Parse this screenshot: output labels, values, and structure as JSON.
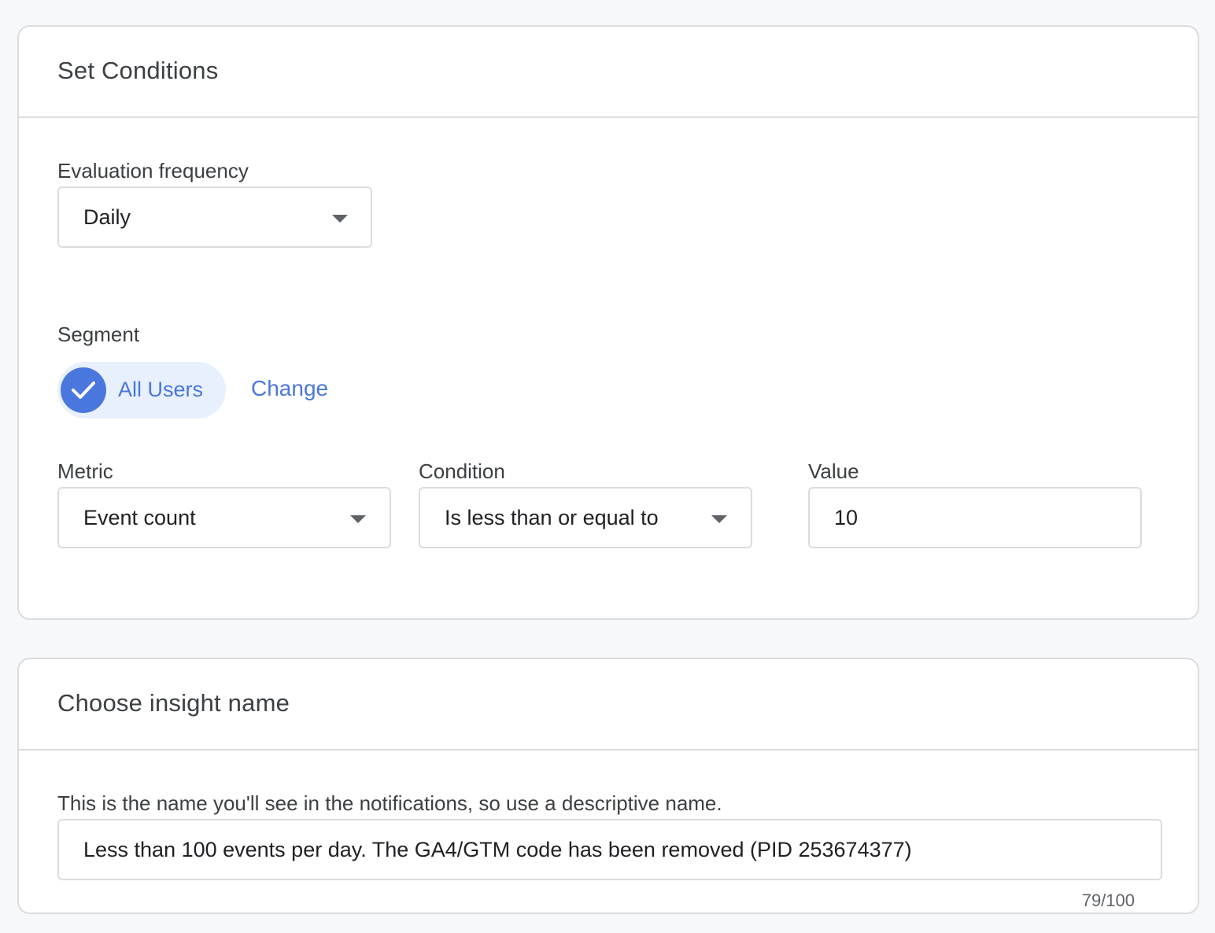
{
  "conditions": {
    "title": "Set Conditions",
    "evaluation_frequency": {
      "label": "Evaluation frequency",
      "value": "Daily"
    },
    "segment": {
      "label": "Segment",
      "chip_label": "All Users",
      "change_label": "Change"
    },
    "metric": {
      "label": "Metric",
      "value": "Event count"
    },
    "condition": {
      "label": "Condition",
      "value": "Is less than or equal to"
    },
    "value_field": {
      "label": "Value",
      "value": "10"
    }
  },
  "insight_name": {
    "title": "Choose insight name",
    "helper": "This is the name you'll see in the notifications, so use a descriptive name.",
    "value": "Less than 100 events per day. The GA4/GTM code has been removed (PID 253674377)",
    "counter": "79/100"
  },
  "icons": {
    "chip_check": "check-icon",
    "dropdown": "chevron-down-icon"
  },
  "colors": {
    "accent": "#4a77dd",
    "chip_background": "#e8f0fe",
    "border": "#dadce0",
    "page_background": "#f7f8fa"
  }
}
